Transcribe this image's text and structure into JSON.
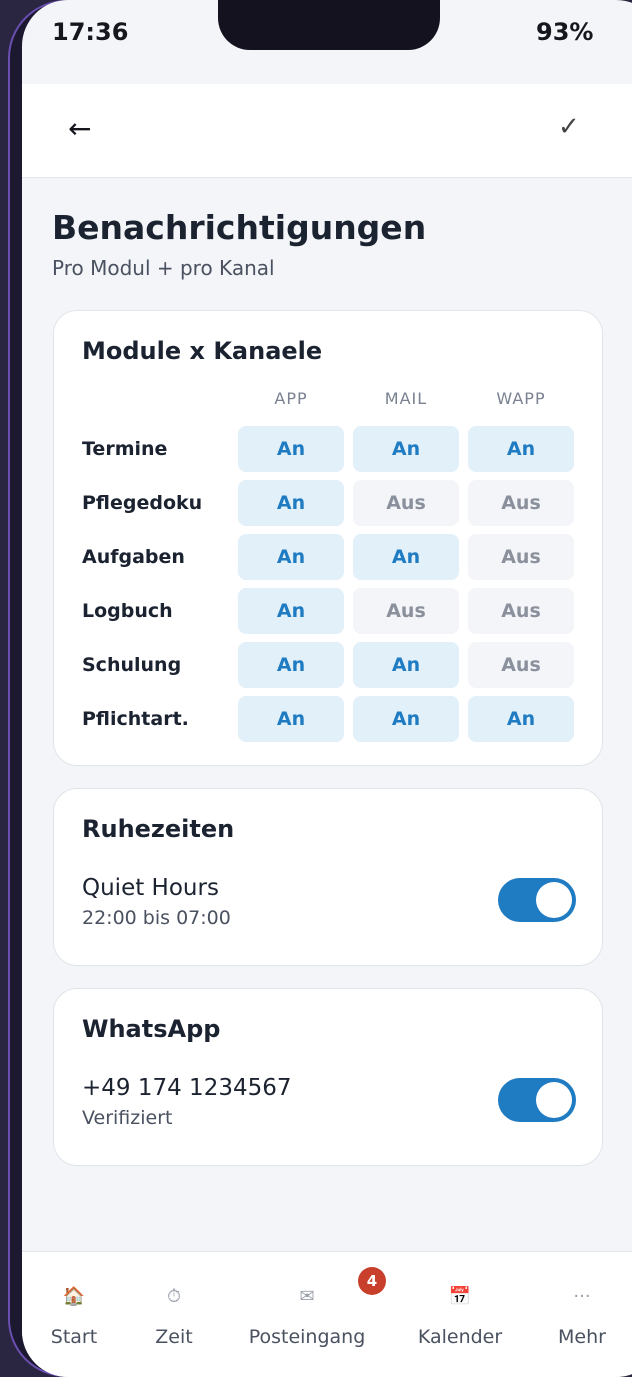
{
  "status": {
    "time": "17:36",
    "battery": "93%"
  },
  "topbar": {
    "back_icon": "←",
    "confirm_icon": "✓"
  },
  "page": {
    "title": "Benachrichtigungen",
    "subtitle": "Pro Modul + pro Kanal"
  },
  "matrix": {
    "title": "Module x Kanaele",
    "columns": [
      "APP",
      "MAIL",
      "WAPP"
    ],
    "rows": [
      {
        "label": "Termine",
        "cells": [
          "An",
          "An",
          "An"
        ]
      },
      {
        "label": "Pflegedoku",
        "cells": [
          "An",
          "Aus",
          "Aus"
        ]
      },
      {
        "label": "Aufgaben",
        "cells": [
          "An",
          "An",
          "Aus"
        ]
      },
      {
        "label": "Logbuch",
        "cells": [
          "An",
          "Aus",
          "Aus"
        ]
      },
      {
        "label": "Schulung",
        "cells": [
          "An",
          "An",
          "Aus"
        ]
      },
      {
        "label": "Pflichtart.",
        "cells": [
          "An",
          "An",
          "An"
        ]
      }
    ]
  },
  "quiet": {
    "title": "Ruhezeiten",
    "label": "Quiet Hours",
    "range": "22:00 bis 07:00",
    "enabled": true
  },
  "whatsapp": {
    "title": "WhatsApp",
    "number": "+49 174 1234567",
    "state": "Verifiziert",
    "enabled": true
  },
  "nav": {
    "items": [
      {
        "label": "Start",
        "icon": "🏠"
      },
      {
        "label": "Zeit",
        "icon": "⏱"
      },
      {
        "label": "Posteingang",
        "icon": "✉"
      },
      {
        "label": "Kalender",
        "icon": "📅"
      },
      {
        "label": "Mehr",
        "icon": "···"
      }
    ],
    "badge": "4"
  },
  "colors": {
    "accent": "#1f7bc2",
    "badge": "#c8402c"
  }
}
